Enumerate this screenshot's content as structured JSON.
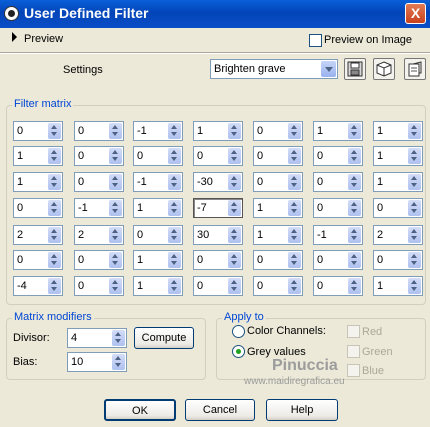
{
  "window": {
    "title": "User Defined Filter",
    "close_glyph": "X"
  },
  "preview": {
    "label": "Preview",
    "preview_on_image_label": "Preview on Image",
    "preview_on_image_checked": false
  },
  "settings": {
    "label": "Settings",
    "preset_value": "Brighten grave"
  },
  "toolbar_icons": [
    "save-icon",
    "cube-icon",
    "load-icon"
  ],
  "filter_matrix": {
    "title": "Filter matrix",
    "rows": [
      [
        "0",
        "0",
        "-1",
        "1",
        "0",
        "1",
        "1"
      ],
      [
        "1",
        "0",
        "0",
        "0",
        "0",
        "0",
        "1"
      ],
      [
        "1",
        "0",
        "-1",
        "-30",
        "0",
        "0",
        "1"
      ],
      [
        "0",
        "-1",
        "1",
        "-7",
        "1",
        "0",
        "0"
      ],
      [
        "2",
        "2",
        "0",
        "30",
        "1",
        "-1",
        "2"
      ],
      [
        "0",
        "0",
        "1",
        "0",
        "0",
        "0",
        "0"
      ],
      [
        "-4",
        "0",
        "1",
        "0",
        "0",
        "0",
        "1"
      ]
    ]
  },
  "matrix_modifiers": {
    "title": "Matrix modifiers",
    "divisor_label": "Divisor:",
    "divisor_value": "4",
    "bias_label": "Bias:",
    "bias_value": "10",
    "compute_label": "Compute"
  },
  "apply_to": {
    "title": "Apply to",
    "color_channels_label": "Color Channels:",
    "grey_values_label": "Grey values",
    "selected": "grey_values",
    "red_label": "Red",
    "green_label": "Green",
    "blue_label": "Blue"
  },
  "watermark": {
    "name": "Pinuccia",
    "url": "www.maidiregrafica.eu"
  },
  "buttons": {
    "ok": "OK",
    "cancel": "Cancel",
    "help": "Help"
  },
  "colors": {
    "title_bar": "#0a5fd8",
    "group_title": "#0046d5",
    "dialog_bg": "#ece9d8",
    "radio_selected": "#21a121"
  }
}
